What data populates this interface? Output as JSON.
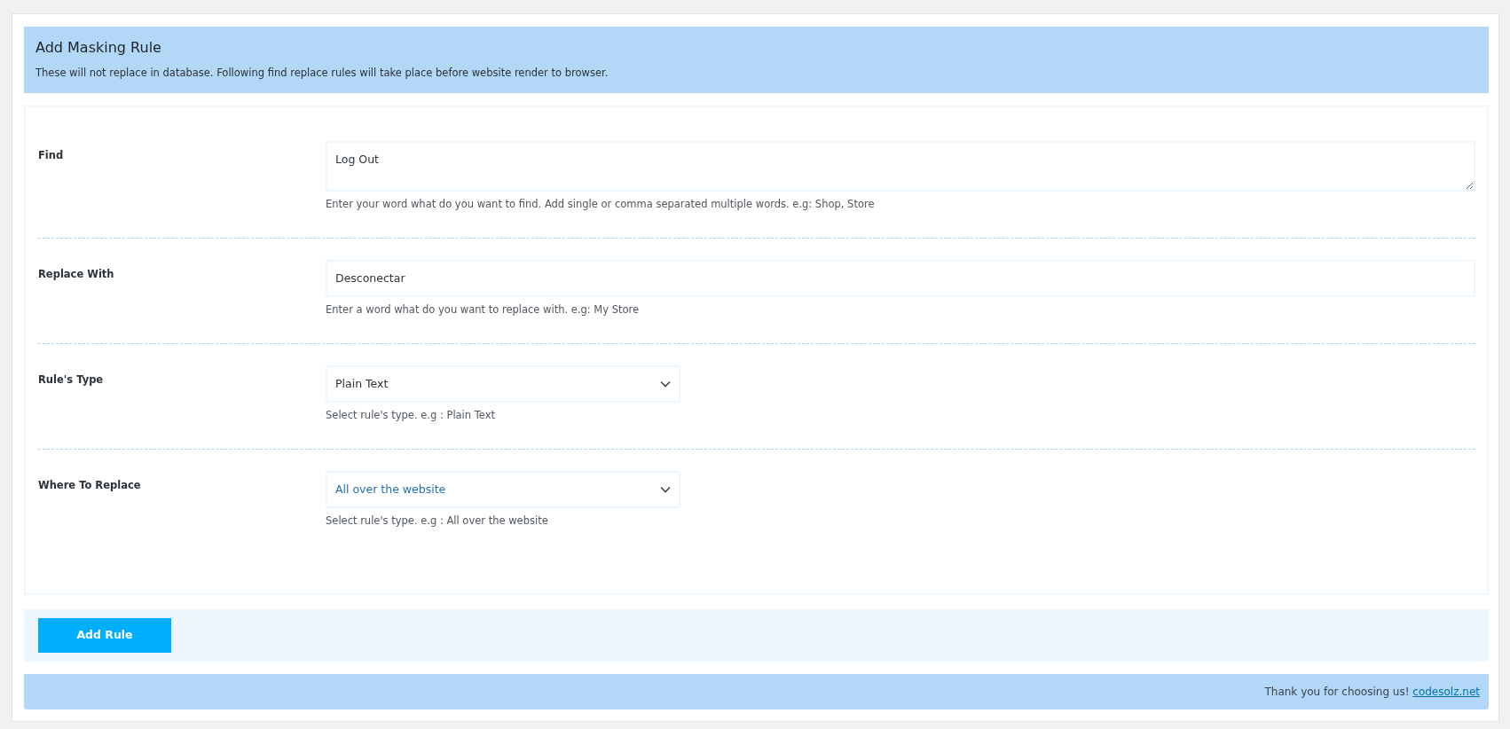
{
  "header": {
    "title": "Add Masking Rule",
    "description": "These will not replace in database. Following find replace rules will take place before website render to browser."
  },
  "rows": [
    {
      "kind": "textarea",
      "label": "Find",
      "value": "Log Out",
      "help": "Enter your word what do you want to find. Add single or comma separated multiple words. e.g: Shop, Store"
    },
    {
      "kind": "input",
      "label": "Replace With",
      "value": "Desconectar",
      "help": "Enter a word what do you want to replace with. e.g: My Store"
    },
    {
      "kind": "select",
      "label": "Rule's Type",
      "value": "Plain Text",
      "help": "Select rule's type. e.g : Plain Text"
    },
    {
      "kind": "select",
      "label": "Where To Replace",
      "value": "All over the website",
      "help": "Select rule's type. e.g : All over the website"
    }
  ],
  "submit_button": "Add Rule",
  "footer": {
    "text": "Thank you for choosing us!",
    "link": "codesolz.net"
  }
}
